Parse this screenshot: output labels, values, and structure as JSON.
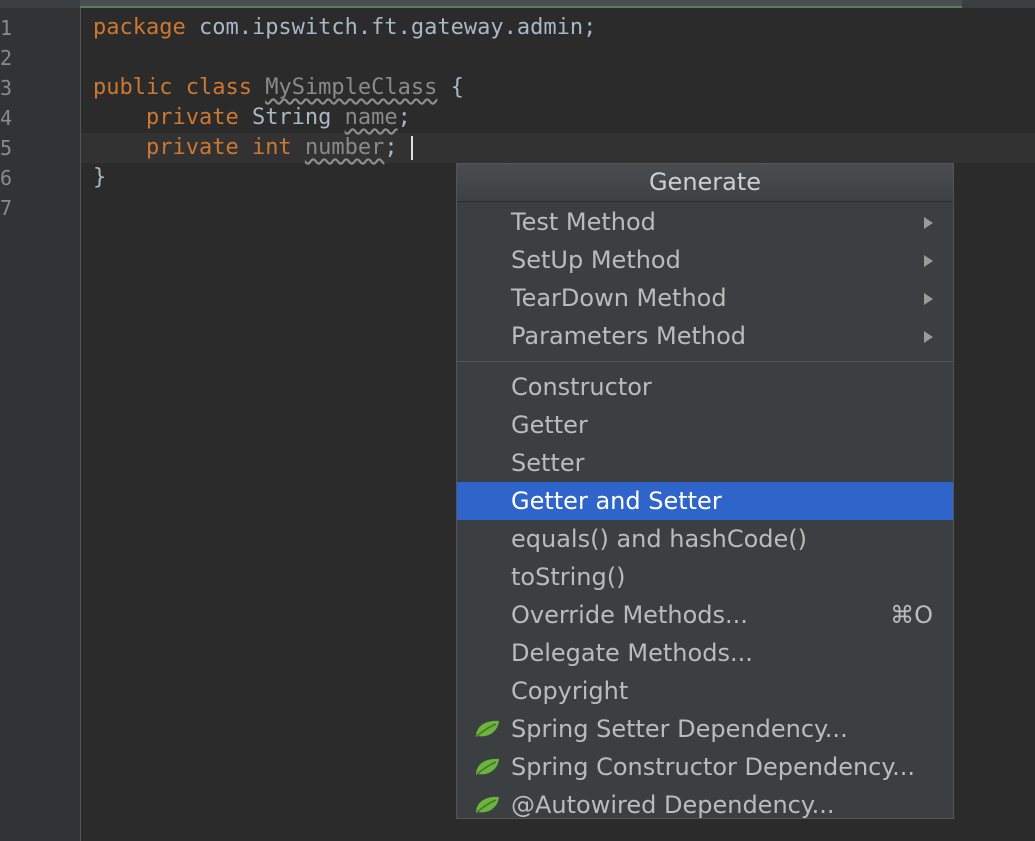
{
  "editor": {
    "line_numbers": [
      "1",
      "2",
      "3",
      "4",
      "5",
      "6",
      "7"
    ],
    "lines": {
      "l1": {
        "kw": "package",
        "rest": " com.ipswitch.ft.gateway.admin;"
      },
      "l3": {
        "kw": "public class",
        "class_name": "MySimpleClass",
        "brace": " {"
      },
      "l4": {
        "kw": "private",
        "type": " String ",
        "field": "name",
        "end": ";"
      },
      "l5": {
        "kw": "private int",
        "field": "number",
        "end": ";"
      },
      "l6": {
        "brace": "}"
      }
    }
  },
  "popup": {
    "title": "Generate",
    "groups": [
      {
        "items": [
          {
            "label": "Test Method",
            "submenu": true
          },
          {
            "label": "SetUp Method",
            "submenu": true
          },
          {
            "label": "TearDown Method",
            "submenu": true
          },
          {
            "label": "Parameters Method",
            "submenu": true
          }
        ]
      },
      {
        "items": [
          {
            "label": "Constructor"
          },
          {
            "label": "Getter"
          },
          {
            "label": "Setter"
          },
          {
            "label": "Getter and Setter",
            "selected": true
          },
          {
            "label": "equals() and hashCode()"
          },
          {
            "label": "toString()"
          },
          {
            "label": "Override Methods...",
            "shortcut": "⌘O"
          },
          {
            "label": "Delegate Methods..."
          },
          {
            "label": "Copyright"
          },
          {
            "label": "Spring Setter Dependency...",
            "icon": "spring-leaf-icon"
          },
          {
            "label": "Spring Constructor Dependency...",
            "icon": "spring-leaf-icon"
          },
          {
            "label": "@Autowired Dependency...",
            "icon": "spring-leaf-icon"
          }
        ]
      }
    ]
  },
  "colors": {
    "background": "#2b2b2b",
    "keyword": "#cc7832",
    "text": "#a9b7c6",
    "selection": "#2f65ca",
    "spring_leaf": "#6db33f"
  }
}
